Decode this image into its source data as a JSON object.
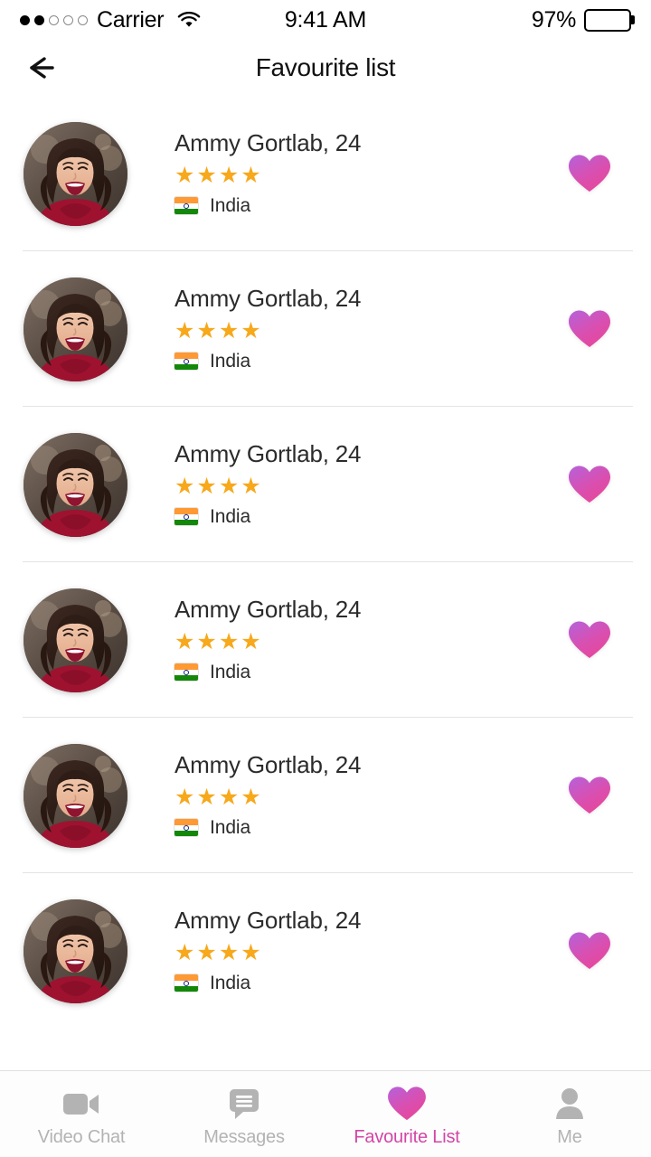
{
  "status_bar": {
    "signal_dots_total": 5,
    "signal_dots_filled": 2,
    "carrier": "Carrier",
    "wifi_icon": "wifi-icon",
    "time": "9:41 AM",
    "battery_percent": "97%",
    "battery_level": 97
  },
  "nav": {
    "back_icon": "back-arrow-icon",
    "title": "Favourite list"
  },
  "colors": {
    "accent_pink": "#d246a6",
    "heart_gradient_start": "#b860d8",
    "heart_gradient_end": "#e8469a",
    "star_gold": "#f7a81b",
    "divider": "#e4e4e4",
    "tab_inactive": "#b3b3b3",
    "text_primary": "#2b2b2b",
    "background": "#ffffff"
  },
  "list": {
    "rating_max": 5,
    "items": [
      {
        "name": "Ammy Gortlab, 24",
        "rating": 4,
        "country": "India",
        "flag": "flag-india",
        "favourite_icon": "heart-icon",
        "favourited": true
      },
      {
        "name": "Ammy Gortlab, 24",
        "rating": 4,
        "country": "India",
        "flag": "flag-india",
        "favourite_icon": "heart-icon",
        "favourited": true
      },
      {
        "name": "Ammy Gortlab, 24",
        "rating": 4,
        "country": "India",
        "flag": "flag-india",
        "favourite_icon": "heart-icon",
        "favourited": true
      },
      {
        "name": "Ammy Gortlab, 24",
        "rating": 4,
        "country": "India",
        "flag": "flag-india",
        "favourite_icon": "heart-icon",
        "favourited": true
      },
      {
        "name": "Ammy Gortlab, 24",
        "rating": 4,
        "country": "India",
        "flag": "flag-india",
        "favourite_icon": "heart-icon",
        "favourited": true
      },
      {
        "name": "Ammy Gortlab, 24",
        "rating": 4,
        "country": "India",
        "flag": "flag-india",
        "favourite_icon": "heart-icon",
        "favourited": true
      }
    ]
  },
  "tabbar": {
    "items": [
      {
        "label": "Video Chat",
        "icon": "video-camera-icon",
        "active": false
      },
      {
        "label": "Messages",
        "icon": "chat-bubble-icon",
        "active": false
      },
      {
        "label": "Favourite List",
        "icon": "heart-icon",
        "active": true
      },
      {
        "label": "Me",
        "icon": "person-icon",
        "active": false
      }
    ]
  }
}
